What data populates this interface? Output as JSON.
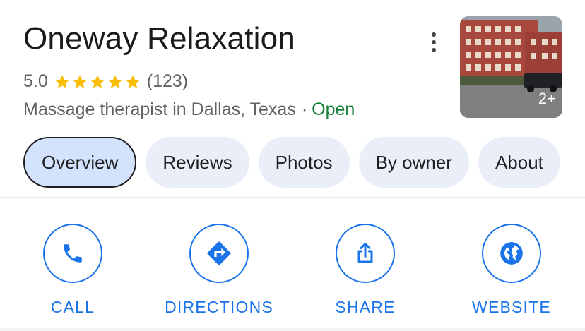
{
  "place": {
    "name": "Oneway Relaxation",
    "rating": "5.0",
    "star_count": 5,
    "reviews_count": "(123)",
    "category": "Massage therapist in Dallas, Texas",
    "separator": "·",
    "status": "Open",
    "photo_count": "2+"
  },
  "icons": {
    "more": "more-vert-icon",
    "star": "star-icon",
    "call": "phone-icon",
    "directions": "directions-icon",
    "share": "share-icon",
    "website": "globe-icon"
  },
  "tabs": [
    {
      "label": "Overview",
      "active": true
    },
    {
      "label": "Reviews",
      "active": false
    },
    {
      "label": "Photos",
      "active": false
    },
    {
      "label": "By owner",
      "active": false
    },
    {
      "label": "About",
      "active": false
    }
  ],
  "actions": {
    "call": "CALL",
    "directions": "DIRECTIONS",
    "share": "SHARE",
    "website": "WEBSITE"
  },
  "colors": {
    "accent": "#1a73e8",
    "star": "#fbbc04",
    "open": "#188038",
    "active_tab": "#d3e3fd",
    "tab": "#e9eef9"
  }
}
